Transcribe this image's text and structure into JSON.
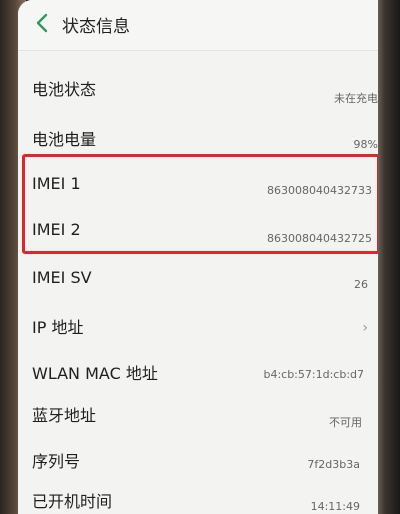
{
  "header": {
    "title": "状态信息"
  },
  "rows": [
    {
      "label": "电池状态",
      "value": "未在充电"
    },
    {
      "label": "电池电量",
      "value": "98%"
    },
    {
      "label": "IMEI 1",
      "value": "863008040432733"
    },
    {
      "label": "IMEI 2",
      "value": "863008040432725"
    },
    {
      "label": "IMEI SV",
      "value": "26"
    },
    {
      "label": "IP 地址",
      "value": ""
    },
    {
      "label": "WLAN MAC 地址",
      "value": "b4:cb:57:1d:cb:d7"
    },
    {
      "label": "蓝牙地址",
      "value": "不可用"
    },
    {
      "label": "序列号",
      "value": "7f2d3b3a"
    },
    {
      "label": "已开机时间",
      "value": "14:11:49"
    }
  ],
  "icons": {
    "back": "chevron-left-icon",
    "ip_arrow": "chevron-right-icon"
  },
  "colors": {
    "highlight": "#e3232d",
    "back_icon": "#2e9b5e"
  }
}
